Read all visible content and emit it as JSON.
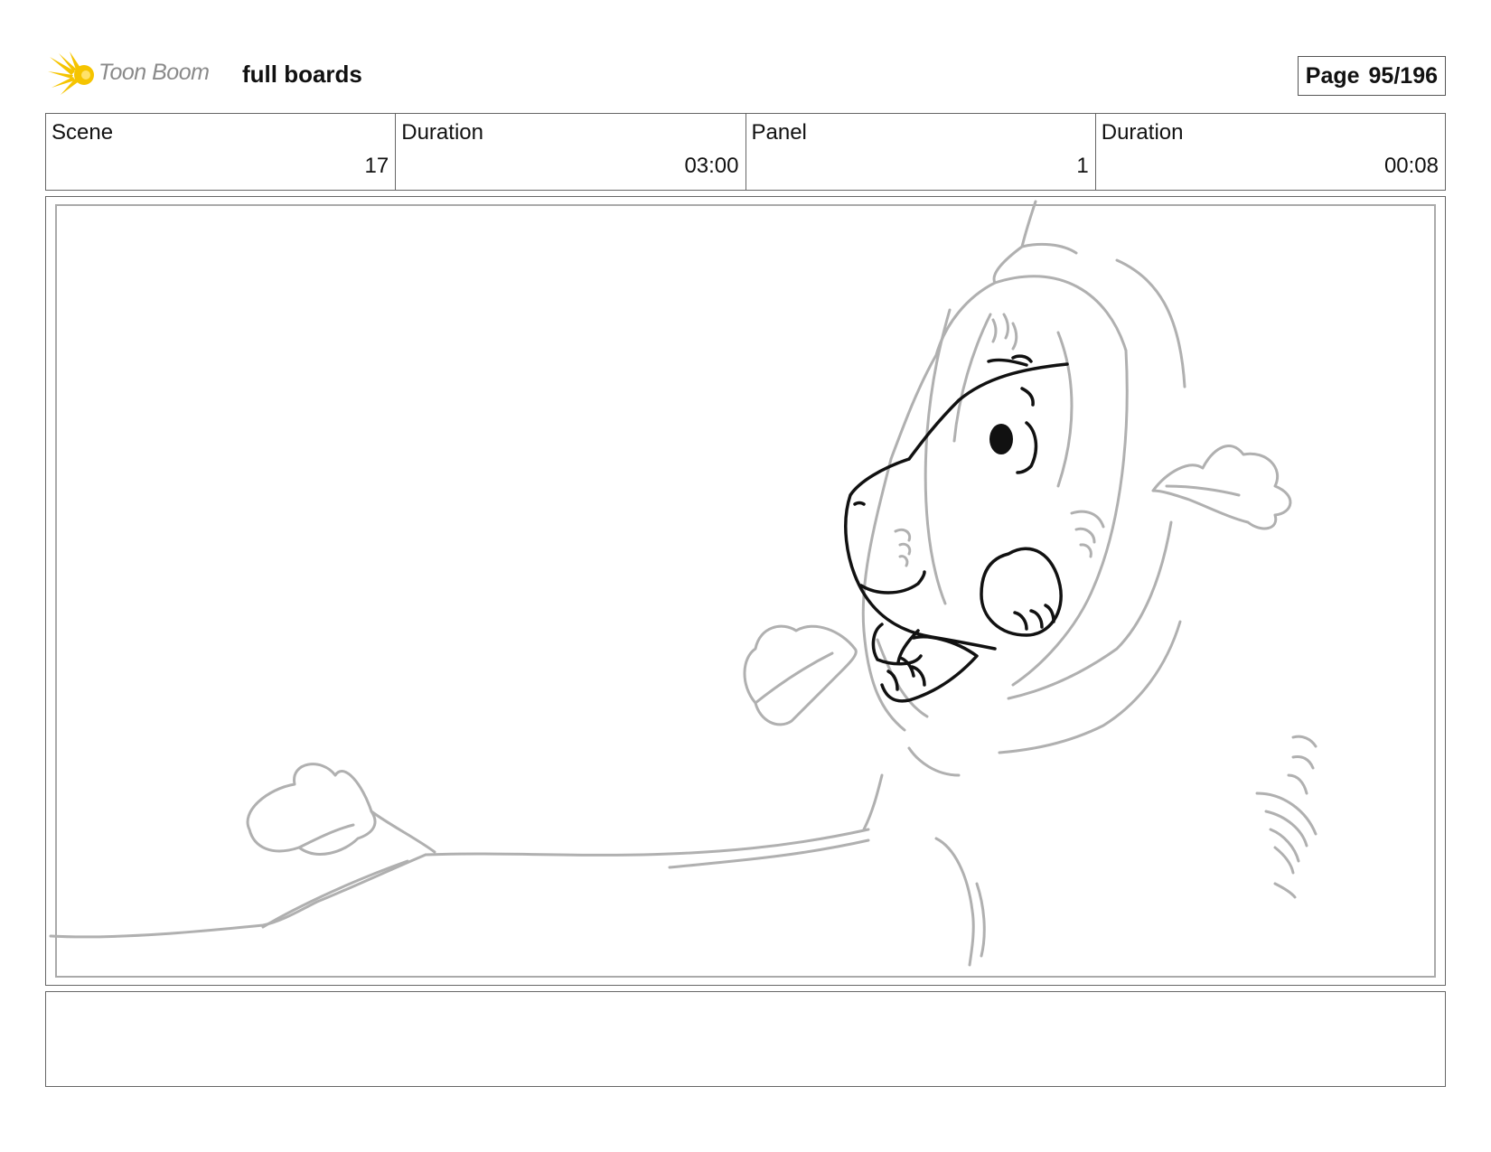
{
  "header": {
    "logo_text": "Toon Boom",
    "project_title": "full boards",
    "page_label": "Page",
    "page_value": "95/196"
  },
  "info": {
    "scene_label": "Scene",
    "scene_value": "17",
    "scene_duration_label": "Duration",
    "scene_duration_value": "03:00",
    "panel_label": "Panel",
    "panel_value": "1",
    "panel_duration_label": "Duration",
    "panel_duration_value": "00:08"
  },
  "notes": {
    "text": ""
  },
  "colors": {
    "sketch_gray": "#b0b0b0",
    "ink_black": "#111111",
    "logo_yellow": "#f5c400"
  },
  "icons": {
    "logo": "toon-boom-logo-icon"
  }
}
